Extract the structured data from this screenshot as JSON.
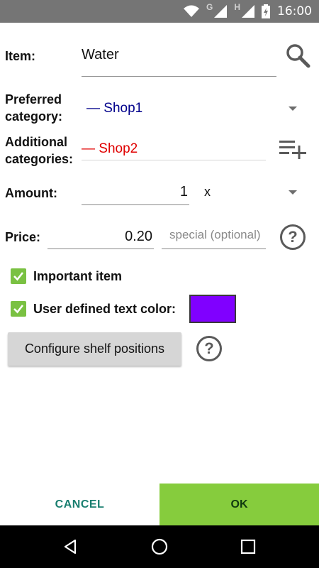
{
  "status_bar": {
    "time": "16:00",
    "network_g": "G",
    "network_h": "H",
    "icons": [
      "wifi-icon",
      "signal-icon",
      "signal-icon",
      "battery-icon"
    ]
  },
  "form": {
    "item": {
      "label": "Item:",
      "value": "Water"
    },
    "preferred_category": {
      "label": "Preferred category:",
      "value": "— Shop1",
      "color": "#00008b"
    },
    "additional_categories": {
      "label": "Additional categories:",
      "value": "— Shop2",
      "color": "#e00000"
    },
    "amount": {
      "label": "Amount:",
      "value": "1",
      "unit": "x"
    },
    "price": {
      "label": "Price:",
      "value": "0.20",
      "special_placeholder": "special (optional)"
    },
    "important_item": {
      "label": "Important item",
      "checked": true
    },
    "user_text_color": {
      "label": "User defined text color:",
      "checked": true,
      "color": "#8000ff"
    },
    "configure_button": "Configure shelf positions",
    "help_glyph": "?"
  },
  "footer": {
    "cancel": "CANCEL",
    "ok": "OK"
  },
  "colors": {
    "accent_green": "#86cc3d",
    "cancel_text": "#1a7f70",
    "checkbox": "#7ac142"
  }
}
